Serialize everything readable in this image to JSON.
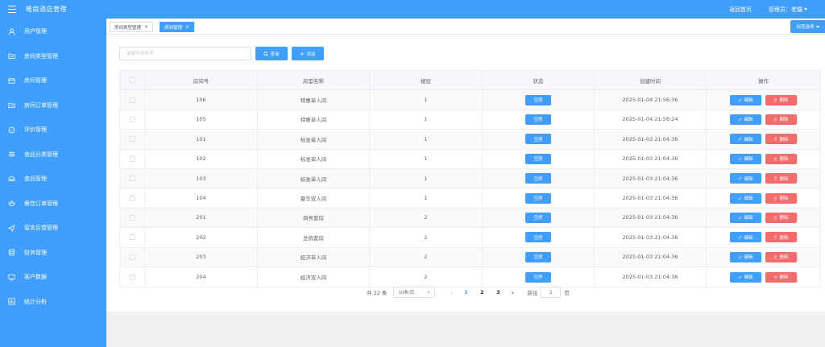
{
  "app": {
    "title": "唯庭酒店管理"
  },
  "header": {
    "back_home": "返回首页",
    "admin_label": "管理员：老猫"
  },
  "sidebar": {
    "items": [
      {
        "label": "用户管理",
        "icon": "user-icon"
      },
      {
        "label": "房间类型管理",
        "icon": "folder-icon"
      },
      {
        "label": "房间管理",
        "icon": "card-icon"
      },
      {
        "label": "房间订单管理",
        "icon": "folder-icon"
      },
      {
        "label": "评价管理",
        "icon": "chat-icon"
      },
      {
        "label": "食品分类管理",
        "icon": "sliders-icon"
      },
      {
        "label": "食品管理",
        "icon": "food-icon"
      },
      {
        "label": "餐饮订单管理",
        "icon": "bowl-icon"
      },
      {
        "label": "留言反馈管理",
        "icon": "send-icon"
      },
      {
        "label": "财务管理",
        "icon": "database-icon"
      },
      {
        "label": "客户数据",
        "icon": "monitor-icon"
      },
      {
        "label": "统计分析",
        "icon": "chart-icon"
      }
    ]
  },
  "tabs": [
    {
      "label": "房间类型管理",
      "active": false
    },
    {
      "label": "房间管理",
      "active": true
    }
  ],
  "tab_options": "标签选项",
  "toolbar": {
    "search_placeholder": "请填写房间号",
    "search_label": "查询",
    "add_label": "添加"
  },
  "table": {
    "columns": [
      "房间号",
      "房型名称",
      "楼层",
      "状态",
      "创建时间",
      "操作"
    ],
    "rows": [
      {
        "room_no": "106",
        "type": "特惠单人间",
        "floor": "1",
        "status": "空房",
        "created": "2025-01-04 21:56:36"
      },
      {
        "room_no": "105",
        "type": "特惠单人间",
        "floor": "1",
        "status": "空房",
        "created": "2025-01-04 21:56:24"
      },
      {
        "room_no": "101",
        "type": "标准单人间",
        "floor": "1",
        "status": "空房",
        "created": "2025-01-03 21:04:36"
      },
      {
        "room_no": "102",
        "type": "标准单人间",
        "floor": "1",
        "status": "空房",
        "created": "2025-01-03 21:04:36"
      },
      {
        "room_no": "103",
        "type": "标准单人间",
        "floor": "1",
        "status": "空房",
        "created": "2025-01-03 21:04:36"
      },
      {
        "room_no": "104",
        "type": "豪华双人间",
        "floor": "1",
        "status": "空房",
        "created": "2025-01-03 21:04:36"
      },
      {
        "room_no": "201",
        "type": "商务套房",
        "floor": "2",
        "status": "空房",
        "created": "2025-01-03 21:04:36"
      },
      {
        "room_no": "202",
        "type": "总统套房",
        "floor": "2",
        "status": "空房",
        "created": "2025-01-03 21:04:36"
      },
      {
        "room_no": "203",
        "type": "经济单人间",
        "floor": "2",
        "status": "空房",
        "created": "2025-01-03 21:04:36"
      },
      {
        "room_no": "204",
        "type": "经济双人间",
        "floor": "2",
        "status": "空房",
        "created": "2025-01-03 21:04:36"
      }
    ],
    "edit_label": "编辑",
    "delete_label": "删除"
  },
  "pagination": {
    "total": "共 22 条",
    "page_size": "10条/页",
    "pages": [
      "1",
      "2",
      "3"
    ],
    "current": "1",
    "goto_label": "前往",
    "goto_value": "1",
    "page_unit": "页"
  },
  "colors": {
    "primary": "#409eff",
    "danger": "#f56c6c",
    "bg": "#f0f2f5"
  }
}
